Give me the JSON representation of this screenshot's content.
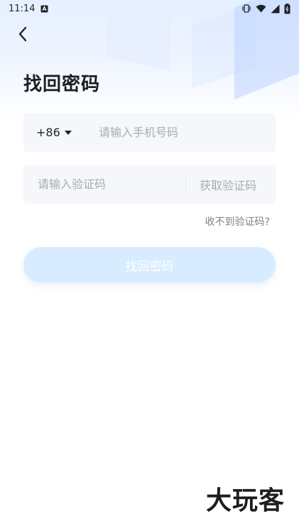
{
  "status_bar": {
    "time": "11:14"
  },
  "header": {
    "title": "找回密码"
  },
  "phone_field": {
    "country_code": "+86",
    "placeholder": "请输入手机号码"
  },
  "code_field": {
    "placeholder": "请输入验证码",
    "get_code_label": "获取验证码"
  },
  "help_link": "收不到验证码?",
  "submit_label": "找回密码",
  "watermark": "大玩客",
  "colors": {
    "primary_disabled": "#d7ecff",
    "field_bg": "#f6f7fb",
    "placeholder": "#a7abb3"
  }
}
